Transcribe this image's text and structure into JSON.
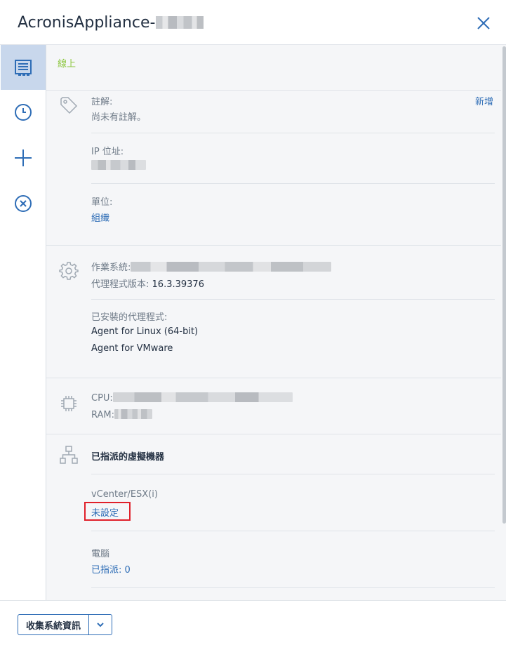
{
  "header": {
    "title": "AcronisAppliance-"
  },
  "sidebar": {
    "items": [
      {
        "icon": "overview-icon"
      },
      {
        "icon": "clock-icon"
      },
      {
        "icon": "plus-icon"
      },
      {
        "icon": "remove-circle-icon"
      }
    ]
  },
  "status": {
    "text": "線上",
    "color": "#8cc63f"
  },
  "details": {
    "comment_label": "註解:",
    "comment_add": "新增",
    "comment_value": "尚未有註解。",
    "ip_label": "IP 位址:",
    "unit_label": "單位:",
    "unit_value": "組織"
  },
  "system": {
    "os_label": "作業系統:",
    "agent_version_label": "代理程式版本:",
    "agent_version_value": "16.3.39376",
    "installed_agents_label": "已安裝的代理程式:",
    "agents": [
      "Agent for Linux (64-bit)",
      "Agent for VMware"
    ]
  },
  "hardware": {
    "cpu_label": "CPU:",
    "ram_label": "RAM:"
  },
  "vms": {
    "title": "已指派的虛擬機器",
    "vcenter_label": "vCenter/ESX(i)",
    "vcenter_value": "未設定",
    "computer_label": "電腦",
    "computer_value": "已指派: 0"
  },
  "footer": {
    "collect_button": "收集系統資訊"
  },
  "colors": {
    "accent": "#2e6db6",
    "highlight": "#e0202a",
    "active_nav": "#c8d7ec"
  }
}
